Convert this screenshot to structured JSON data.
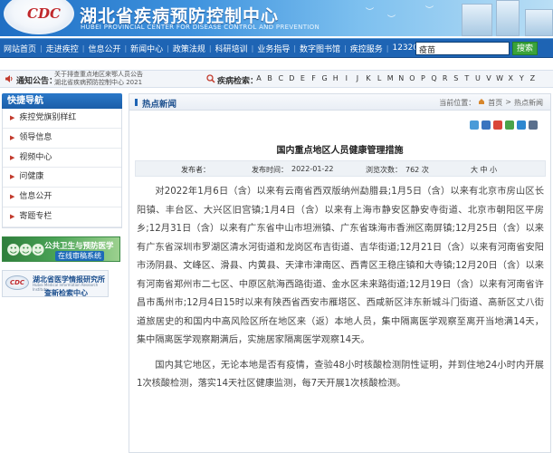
{
  "header": {
    "logo_text": "CDC",
    "title": "湖北省疾病预防控制中心",
    "subtitle": "HUBEI PROVINCIAL CENTER FOR DISEASE CONTROL AND PREVENTION"
  },
  "nav": {
    "items": [
      "网站首页",
      "走进疾控",
      "信息公开",
      "新闻中心",
      "政策法规",
      "科研培训",
      "业务指导",
      "数字图书馆",
      "疾控服务",
      "12320"
    ],
    "search_value": "疫苗",
    "search_button": "搜索"
  },
  "notice": {
    "label": "通知公告：",
    "lines": [
      "关于排查重点地区来鄂人员公告",
      "湖北省疾病预防控制中心 2021"
    ],
    "disease_label": "疾病检索：",
    "letters": [
      "A",
      "B",
      "C",
      "D",
      "E",
      "F",
      "G",
      "H",
      "I",
      "J",
      "K",
      "L",
      "M",
      "N",
      "O",
      "P",
      "Q",
      "R",
      "S",
      "T",
      "U",
      "V",
      "W",
      "X",
      "Y",
      "Z"
    ]
  },
  "sidebar": {
    "title": "快捷导航",
    "items": [
      "疾控党旗别样红",
      "领导信息",
      "视频中心",
      "问健康",
      "信息公开",
      "寄题专栏"
    ]
  },
  "banners": {
    "health_title": "公共卫生与预防医学",
    "health_sub": "在线审稿系统",
    "lib_logo": "CDC",
    "lib_title": "湖北省医学情报研究所",
    "lib_eng": "Hubei Medical Information Research Institute",
    "lib_sub": "查新检索中心"
  },
  "main": {
    "section_title": "热点新闻",
    "breadcrumb": [
      "当前位置：",
      "首页",
      ">",
      "热点新闻"
    ],
    "article_title": "国内重点地区人员健康管理措施",
    "publisher_label": "发布者：",
    "publisher_value": "",
    "time_label": "发布时间：",
    "time_value": "2022-01-22",
    "views_label": "浏览次数：",
    "views_value": "762 次",
    "font_size": "大 中 小",
    "paragraphs": [
      "对2022年1月6日（含）以来有云南省西双版纳州勐腊县;1月5日（含）以来有北京市房山区长阳镇、丰台区、大兴区旧宫镇;1月4日（含）以来有上海市静安区静安寺街道、北京市朝阳区平房乡;12月31日（含）以来有广东省中山市坦洲镇、广东省珠海市香洲区南屏镇;12月25日（含）以来有广东省深圳市罗湖区清水河街道和龙岗区布吉街道、吉华街道;12月21日（含）以来有河南省安阳市汤阴县、文峰区、滑县、内黄县、天津市津南区、西青区王稳庄镇和大寺镇;12月20日（含）以来有河南省郑州市二七区、中原区航海西路街道、金水区未来路街道;12月19日（含）以来有河南省许昌市禹州市;12月4日15时以来有陕西省西安市雁塔区、西咸新区沣东新城斗门街道、高新区丈八街道旅居史的和国内中高风险区所在地区来（返）本地人员，集中隔离医学观察至离开当地满14天，集中隔离医学观察期满后，实施居家隔离医学观察14天。",
      "国内其它地区，无论本地是否有疫情，查验48小时核酸检测阴性证明，并到住地24小时内开展1次核酸检测，落实14天社区健康监测，每7天开展1次核酸检测。"
    ]
  },
  "colors": {
    "nav_bg": "#1e64b4",
    "accent": "#1b4f8e",
    "search_btn": "#3aa33a",
    "arrow": "#c23a2c"
  }
}
